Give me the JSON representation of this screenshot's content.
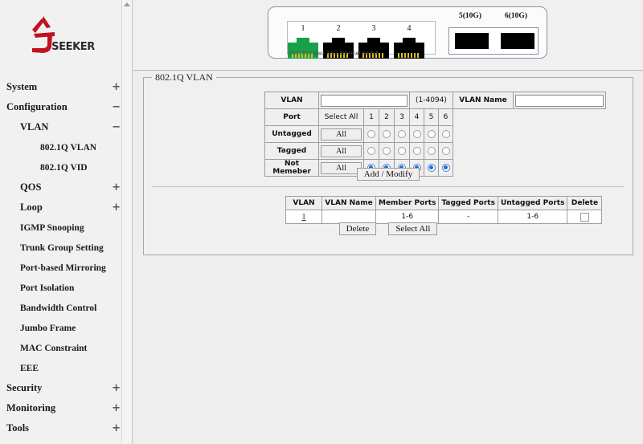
{
  "brand": {
    "name": "SEEKER",
    "logo_icon": "seeker-logo-icon",
    "accent_color": "#c1121f"
  },
  "sidebar": {
    "items": [
      {
        "label": "System",
        "level": 0,
        "toggle": "+",
        "icon": "plus-icon"
      },
      {
        "label": "Configuration",
        "level": 0,
        "toggle": "−",
        "icon": "minus-icon"
      },
      {
        "label": "VLAN",
        "level": 1,
        "toggle": "−",
        "icon": "minus-icon"
      },
      {
        "label": "802.1Q VLAN",
        "level": 2,
        "toggle": ""
      },
      {
        "label": "802.1Q VID",
        "level": 2,
        "toggle": ""
      },
      {
        "label": "QOS",
        "level": 1,
        "toggle": "+",
        "icon": "plus-icon"
      },
      {
        "label": "Loop",
        "level": 1,
        "toggle": "+",
        "icon": "plus-icon"
      },
      {
        "label": "IGMP Snooping",
        "level": 1,
        "toggle": ""
      },
      {
        "label": "Trunk Group Setting",
        "level": 1,
        "toggle": ""
      },
      {
        "label": "Port-based Mirroring",
        "level": 1,
        "toggle": ""
      },
      {
        "label": "Port Isolation",
        "level": 1,
        "toggle": ""
      },
      {
        "label": "Bandwidth Control",
        "level": 1,
        "toggle": ""
      },
      {
        "label": "Jumbo Frame",
        "level": 1,
        "toggle": ""
      },
      {
        "label": "MAC Constraint",
        "level": 1,
        "toggle": ""
      },
      {
        "label": "EEE",
        "level": 1,
        "toggle": ""
      },
      {
        "label": "Security",
        "level": 0,
        "toggle": "+",
        "icon": "plus-icon"
      },
      {
        "label": "Monitoring",
        "level": 0,
        "toggle": "+",
        "icon": "plus-icon"
      },
      {
        "label": "Tools",
        "level": 0,
        "toggle": "+",
        "icon": "plus-icon"
      }
    ]
  },
  "switch_panel": {
    "caption": "Web Managed 2.5G Ethernet Switch",
    "rj45_ports": [
      {
        "number": "1",
        "state": "active",
        "color": "#18a04a"
      },
      {
        "number": "2",
        "state": "inactive",
        "color": "#000000"
      },
      {
        "number": "3",
        "state": "inactive",
        "color": "#000000"
      },
      {
        "number": "4",
        "state": "inactive",
        "color": "#000000"
      }
    ],
    "sfp_ports": [
      {
        "label": "5(10G)"
      },
      {
        "label": "6(10G)"
      }
    ]
  },
  "panel": {
    "legend": "802.1Q VLAN"
  },
  "vlan_form": {
    "vlan_label": "VLAN",
    "vlan_value": "",
    "vlan_placeholder": "",
    "vlan_range_hint": "(1-4094)",
    "vlan_name_label": "VLAN Name",
    "vlan_name_value": "",
    "vlan_name_placeholder": "",
    "port_label": "Port",
    "select_all_label": "Select All",
    "all_button_label": "All",
    "port_numbers": [
      "1",
      "2",
      "3",
      "4",
      "5",
      "6"
    ],
    "rows": [
      {
        "label": "Untagged",
        "selected": [
          false,
          false,
          false,
          false,
          false,
          false
        ]
      },
      {
        "label": "Tagged",
        "selected": [
          false,
          false,
          false,
          false,
          false,
          false
        ]
      },
      {
        "label": "Not Memeber",
        "selected": [
          true,
          true,
          true,
          true,
          true,
          true
        ]
      }
    ],
    "submit_label": "Add / Modify"
  },
  "vlan_table": {
    "headers": [
      "VLAN",
      "VLAN Name",
      "Member Ports",
      "Tagged Ports",
      "Untagged Ports",
      "Delete"
    ],
    "rows": [
      {
        "vlan": "1",
        "vlan_name": "",
        "member_ports": "1-6",
        "tagged_ports": "-",
        "untagged_ports": "1-6",
        "delete_checked": false
      }
    ],
    "delete_label": "Delete",
    "select_all_label": "Select All"
  }
}
